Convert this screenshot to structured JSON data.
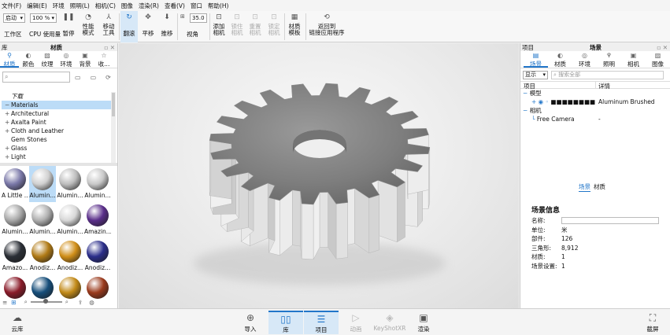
{
  "menu": [
    "文件(F)",
    "编辑(E)",
    "环境",
    "照明(L)",
    "相机(C)",
    "图像",
    "渲染(R)",
    "查看(V)",
    "窗口",
    "帮助(H)"
  ],
  "toolbar": {
    "startup_value": "启动",
    "zoom_value": "100 %",
    "workspace_label": "工作区",
    "cpu_label": "CPU 使用量",
    "pause_label": "暂停",
    "perf_label": "性能\n模式",
    "move_label": "移动\n工具",
    "tumble_label": "翻滚",
    "pan_label": "平移",
    "dolly_label": "推移",
    "fov_value": "35.0",
    "view_label": "视角",
    "add_camera_label": "添加\n相机",
    "lock_camera_label": "锁住\n相机",
    "reset_camera_label": "重置\n相机",
    "pin_camera_label": "锁定\n相机",
    "material_template_label": "材质\n模板",
    "return_label": "返回到\n链接应用程序"
  },
  "left_panel": {
    "dock_label": "库",
    "title": "材质",
    "tabs": [
      "材质",
      "颜色",
      "纹理",
      "环境",
      "背景",
      "收..."
    ],
    "search_placeholder": "",
    "tree": [
      {
        "label": "下载",
        "prefix": "",
        "selected": false
      },
      {
        "label": "Materials",
        "prefix": "−",
        "selected": true
      },
      {
        "label": "Architectural",
        "prefix": "+",
        "selected": false
      },
      {
        "label": "Axalta Paint",
        "prefix": "+",
        "selected": false
      },
      {
        "label": "Cloth and Leather",
        "prefix": "+",
        "selected": false
      },
      {
        "label": "Gem Stones",
        "prefix": "",
        "selected": false
      },
      {
        "label": "Glass",
        "prefix": "+",
        "selected": false
      },
      {
        "label": "Light",
        "prefix": "+",
        "selected": false
      }
    ],
    "materials": [
      {
        "label": "A Little ...",
        "color": "#7a78a8"
      },
      {
        "label": "Alumin...",
        "color": "#d0d0d0"
      },
      {
        "label": "Alumin...",
        "color": "#bdbdbd"
      },
      {
        "label": "Alumin...",
        "color": "#c8c8c8"
      },
      {
        "label": "Alumin...",
        "color": "#a8a8a8"
      },
      {
        "label": "Alumin...",
        "color": "#b0b0b0"
      },
      {
        "label": "Alumin...",
        "color": "#d8d8d8"
      },
      {
        "label": "Amazin...",
        "color": "#5a2e8a"
      },
      {
        "label": "Amazo...",
        "color": "#2b2f36"
      },
      {
        "label": "Anodiz...",
        "color": "#b07a16"
      },
      {
        "label": "Anodiz...",
        "color": "#d08e18"
      },
      {
        "label": "Anodiz...",
        "color": "#2b2e8a"
      },
      {
        "label": "",
        "color": "#8a1c2a"
      },
      {
        "label": "",
        "color": "#164e7a"
      },
      {
        "label": "",
        "color": "#c28a18"
      },
      {
        "label": "",
        "color": "#9a3a1c"
      }
    ]
  },
  "right_panel": {
    "dock_label": "项目",
    "title": "场景",
    "tabs": [
      "场景",
      "材质",
      "环境",
      "照明",
      "相机",
      "图像"
    ],
    "display_label": "显示",
    "search_placeholder": "搜索全部",
    "col_item": "项目",
    "col_detail": "详情",
    "tree": [
      {
        "label": "模型",
        "detail": "",
        "depth": 0
      },
      {
        "label": "■■■■■■■■",
        "detail": "Aluminum Brushed",
        "depth": 1
      },
      {
        "label": "相机",
        "detail": "",
        "depth": 0
      },
      {
        "label": "Free Camera",
        "detail": "-",
        "depth": 1
      }
    ],
    "sub_tabs": [
      "场景",
      "材质"
    ],
    "info_title": "场景信息",
    "info": [
      {
        "k": "名称:",
        "v": ""
      },
      {
        "k": "单位:",
        "v": "米"
      },
      {
        "k": "部件:",
        "v": "126"
      },
      {
        "k": "三角形:",
        "v": "8,912"
      },
      {
        "k": "材质:",
        "v": "1"
      },
      {
        "k": "场景设置:",
        "v": "1"
      }
    ]
  },
  "bottom": {
    "cloud_label": "云库",
    "import_label": "导入",
    "library_label": "库",
    "project_label": "项目",
    "animation_label": "动画",
    "keyshotxr_label": "KeyShotXR",
    "render_label": "渲染",
    "screenshot_label": "截屏"
  },
  "colors": {
    "accent": "#2276c9",
    "selection": "#bcdcf7"
  }
}
